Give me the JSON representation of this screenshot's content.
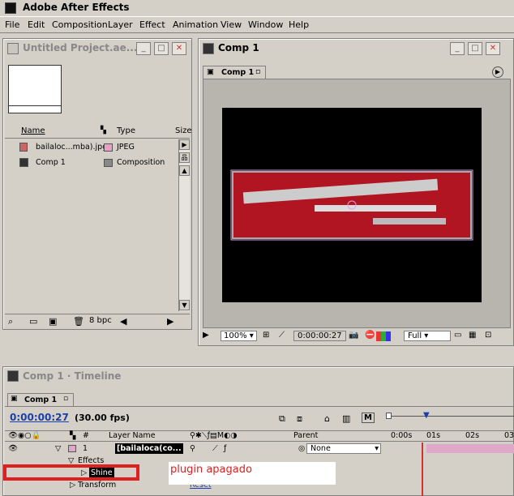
{
  "app": {
    "title": "Adobe After Effects"
  },
  "menu": [
    "File",
    "Edit",
    "Composition",
    "Layer",
    "Effect",
    "Animation",
    "View",
    "Window",
    "Help"
  ],
  "project": {
    "title": "Untitled Project.ae...",
    "columns": {
      "name": "Name",
      "type": "Type",
      "size": "Size"
    },
    "items": [
      {
        "name": "bailaloc...mba).jpg",
        "type": "JPEG",
        "color": "#e8a0c8"
      },
      {
        "name": "Comp 1",
        "type": "Composition",
        "color": "#888888"
      }
    ],
    "footer": {
      "bpc": "8 bpc"
    }
  },
  "comp": {
    "title": "Comp 1",
    "tab": "Comp 1",
    "zoom": "100%",
    "timecode": "0:00:00:27",
    "resolution": "Full"
  },
  "timeline": {
    "title": "Comp 1 · Timeline",
    "tab": "Comp 1",
    "timecode": "0:00:00:27",
    "fps": "(30.00 fps)",
    "columns": {
      "num": "#",
      "layer_name": "Layer Name",
      "parent": "Parent"
    },
    "ruler": [
      "0:00s",
      "01s",
      "02s",
      "03"
    ],
    "layer": {
      "num": "1",
      "name": "[bailaloca(co...",
      "parent": "None"
    },
    "effects_label": "Effects",
    "shine_label": "Shine",
    "transform_label": "Transform",
    "reset_label": "Reset",
    "annotation": "plugin apagado"
  },
  "colors": {
    "accent_red": "#e02020",
    "layer_pink": "#e0a8c8",
    "timecode_blue": "#1a3fa8"
  }
}
